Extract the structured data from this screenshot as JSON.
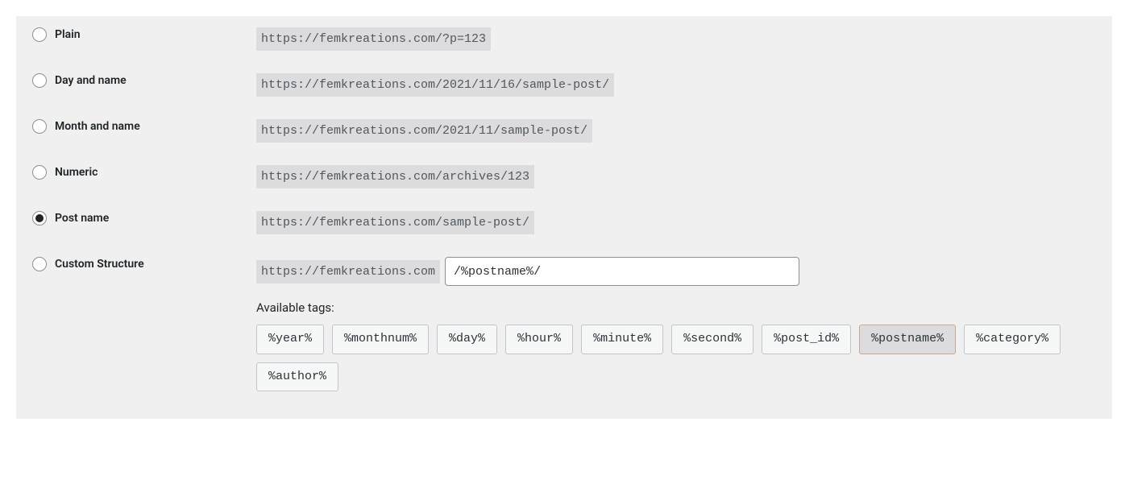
{
  "permalink_options": [
    {
      "id": "plain",
      "label": "Plain",
      "example": "https://femkreations.com/?p=123",
      "checked": false
    },
    {
      "id": "day-name",
      "label": "Day and name",
      "example": "https://femkreations.com/2021/11/16/sample-post/",
      "checked": false
    },
    {
      "id": "month-name",
      "label": "Month and name",
      "example": "https://femkreations.com/2021/11/sample-post/",
      "checked": false
    },
    {
      "id": "numeric",
      "label": "Numeric",
      "example": "https://femkreations.com/archives/123",
      "checked": false
    },
    {
      "id": "post-name",
      "label": "Post name",
      "example": "https://femkreations.com/sample-post/",
      "checked": true
    }
  ],
  "custom": {
    "label": "Custom Structure",
    "base_url": "https://femkreations.com",
    "input_value": "/%postname%/",
    "available_tags_label": "Available tags:",
    "tags": [
      {
        "text": "%year%",
        "active": false
      },
      {
        "text": "%monthnum%",
        "active": false
      },
      {
        "text": "%day%",
        "active": false
      },
      {
        "text": "%hour%",
        "active": false
      },
      {
        "text": "%minute%",
        "active": false
      },
      {
        "text": "%second%",
        "active": false
      },
      {
        "text": "%post_id%",
        "active": false
      },
      {
        "text": "%postname%",
        "active": true
      },
      {
        "text": "%category%",
        "active": false
      },
      {
        "text": "%author%",
        "active": false
      }
    ]
  }
}
